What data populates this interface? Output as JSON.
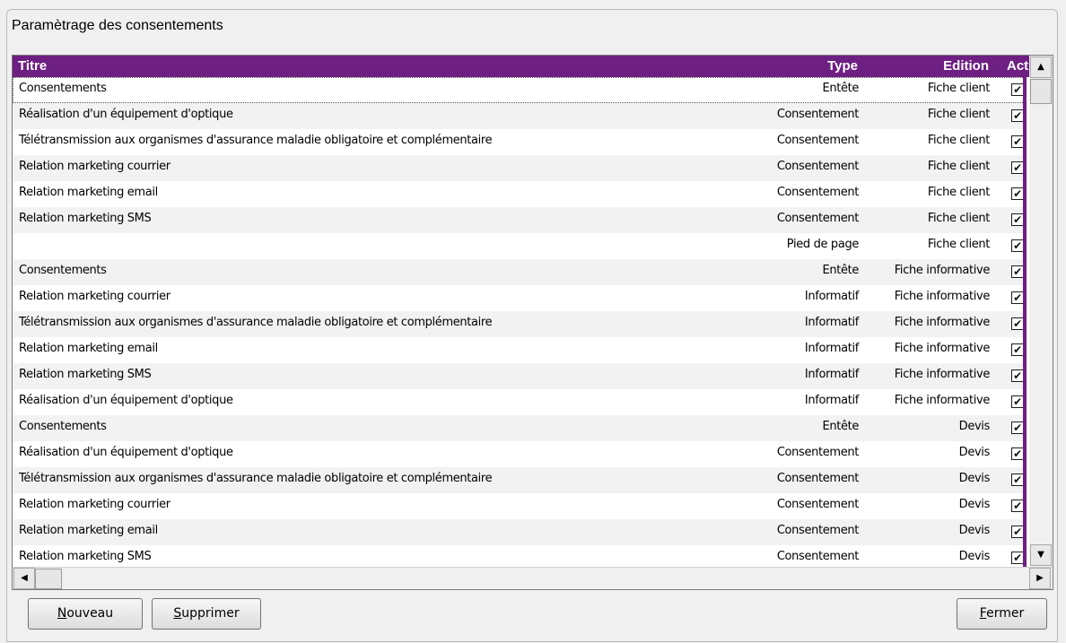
{
  "window": {
    "title": "Paramètrage des consentements"
  },
  "grid": {
    "columns": {
      "titre": "Titre",
      "type": "Type",
      "edition": "Edition",
      "actif": "Actif"
    },
    "rows": [
      {
        "titre": "Consentements",
        "type": "Entête",
        "edition": "Fiche client",
        "checked": true
      },
      {
        "titre": "Réalisation d'un équipement d'optique",
        "type": "Consentement",
        "edition": "Fiche client",
        "checked": true
      },
      {
        "titre": "Télétransmission aux organismes d'assurance maladie obligatoire et complémentaire",
        "type": "Consentement",
        "edition": "Fiche client",
        "checked": true
      },
      {
        "titre": "Relation marketing courrier",
        "type": "Consentement",
        "edition": "Fiche client",
        "checked": true
      },
      {
        "titre": "Relation marketing email",
        "type": "Consentement",
        "edition": "Fiche client",
        "checked": true
      },
      {
        "titre": "Relation marketing SMS",
        "type": "Consentement",
        "edition": "Fiche client",
        "checked": true
      },
      {
        "titre": "",
        "type": "Pied de page",
        "edition": "Fiche client",
        "checked": true
      },
      {
        "titre": "Consentements",
        "type": "Entête",
        "edition": "Fiche informative",
        "checked": true
      },
      {
        "titre": "Relation marketing courrier",
        "type": "Informatif",
        "edition": "Fiche informative",
        "checked": true
      },
      {
        "titre": "Télétransmission aux organismes d'assurance maladie obligatoire et complémentaire",
        "type": "Informatif",
        "edition": "Fiche informative",
        "checked": true
      },
      {
        "titre": "Relation marketing email",
        "type": "Informatif",
        "edition": "Fiche informative",
        "checked": true
      },
      {
        "titre": "Relation marketing SMS",
        "type": "Informatif",
        "edition": "Fiche informative",
        "checked": true
      },
      {
        "titre": "Réalisation d'un équipement d'optique",
        "type": "Informatif",
        "edition": "Fiche informative",
        "checked": true
      },
      {
        "titre": "Consentements",
        "type": "Entête",
        "edition": "Devis",
        "checked": true
      },
      {
        "titre": "Réalisation d'un équipement d'optique",
        "type": "Consentement",
        "edition": "Devis",
        "checked": true
      },
      {
        "titre": "Télétransmission aux organismes d'assurance maladie obligatoire et complémentaire",
        "type": "Consentement",
        "edition": "Devis",
        "checked": true
      },
      {
        "titre": "Relation marketing courrier",
        "type": "Consentement",
        "edition": "Devis",
        "checked": true
      },
      {
        "titre": "Relation marketing email",
        "type": "Consentement",
        "edition": "Devis",
        "checked": true
      },
      {
        "titre": "Relation marketing SMS",
        "type": "Consentement",
        "edition": "Devis",
        "checked": true
      }
    ]
  },
  "buttons": {
    "nouveau": {
      "mnemonic": "N",
      "rest": "ouveau"
    },
    "supprimer": {
      "mnemonic": "S",
      "rest": "upprimer"
    },
    "fermer": {
      "mnemonic": "F",
      "rest": "ermer"
    }
  },
  "colors": {
    "header": "#6d1f82",
    "alt_row": "#f2f2f2",
    "window_bg": "#f0f0f0"
  },
  "icons": {
    "scroll_up": "scroll-up-arrow-icon",
    "scroll_down": "scroll-down-arrow-icon",
    "scroll_left": "scroll-left-arrow-icon",
    "scroll_right": "scroll-right-arrow-icon",
    "check": "checkmark-icon"
  }
}
